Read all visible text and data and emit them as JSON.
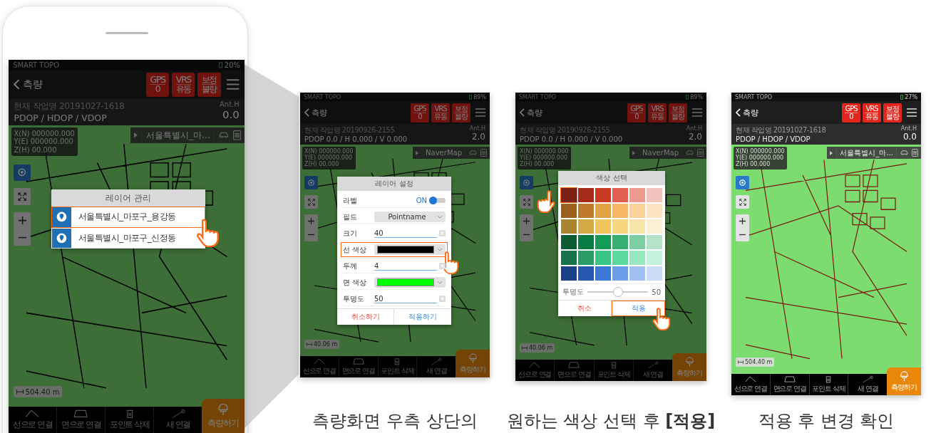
{
  "screens": [
    {
      "kind": "phone",
      "dimmed": true,
      "status": {
        "app": "SMART TOPO",
        "battery": "20%"
      },
      "header": {
        "title": "측량",
        "badges": [
          {
            "label": "GPS",
            "value": "0"
          },
          {
            "label": "VRS",
            "value": "유동"
          },
          {
            "label": "보정",
            "value": "불량"
          }
        ]
      },
      "info": {
        "job": "현재 작업명 20191027-1618",
        "dop": "PDOP / HDOP / VDOP",
        "ant_label": "Ant.H",
        "ant_value": "0.0"
      },
      "map": {
        "color": "#000000",
        "coords": [
          "X(N) 000000.000",
          "Y(E) 000000.000",
          "Z(H) 00.000"
        ],
        "layer": "서울특별시_마...",
        "scale": "504.40 m"
      },
      "tools": [
        "선으로 연결",
        "면으로 연결",
        "포인트 삭제",
        "새 연결"
      ],
      "measure": "측량하기",
      "dialog": {
        "kind": "layer_list",
        "title": "레이어 관리",
        "items": [
          {
            "name": "서울특별시_마포구_용강동",
            "selected": true
          },
          {
            "name": "서울특별시_마포구_신정동",
            "selected": false
          }
        ]
      }
    },
    {
      "kind": "plain",
      "dimmed": true,
      "caption": "측량화면 우측 상단의",
      "status": {
        "app": "SMART TOPO",
        "battery": "89%"
      },
      "header": {
        "title": "측량",
        "badges": [
          {
            "label": "GPS",
            "value": "0"
          },
          {
            "label": "VRS",
            "value": "유동"
          },
          {
            "label": "보정",
            "value": "불량"
          }
        ]
      },
      "info": {
        "job": "현재 작업명 20190926-2155",
        "dop": "PDOP 0.0 / H 0.000 / V 0.000",
        "ant_label": "Ant.H",
        "ant_value": "2.0"
      },
      "map": {
        "color": "#000000",
        "coords": [
          "X(N) 000000.000",
          "Y(E) 000000.000",
          "Z(H) 00.000"
        ],
        "layer": "NaverMap",
        "scale": "40.06 m"
      },
      "tools": [
        "선으로 연결",
        "면으로 연결",
        "포인트 삭제",
        "새 연결"
      ],
      "measure": "측량하기",
      "dialog": {
        "kind": "layer_settings",
        "title": "레이어 설정",
        "rows": [
          {
            "kind": "toggle",
            "label": "라벨",
            "value": "ON",
            "on": true,
            "selected": false
          },
          {
            "kind": "select",
            "label": "필드",
            "value": "Pointname",
            "selected": false
          },
          {
            "kind": "input",
            "label": "크기",
            "value": "40",
            "selected": false
          },
          {
            "kind": "color",
            "label": "선 색상",
            "color": "#000000",
            "selected": true
          },
          {
            "kind": "input",
            "label": "두께",
            "value": "4",
            "selected": false
          },
          {
            "kind": "color",
            "label": "면 색상",
            "color": "#00ff00",
            "selected": false
          },
          {
            "kind": "input",
            "label": "투명도",
            "value": "50",
            "selected": false
          }
        ],
        "buttons": [
          {
            "label": "취소하기",
            "kind": "cancel",
            "selected": false
          },
          {
            "label": "적용하기",
            "kind": "apply",
            "selected": false
          }
        ]
      }
    },
    {
      "kind": "plain",
      "dimmed": true,
      "caption": "원하는 색상 선택 후 **[적용]**",
      "status": {
        "app": "SMART TOPO",
        "battery": "89%"
      },
      "header": {
        "title": "측량",
        "badges": [
          {
            "label": "GPS",
            "value": "0"
          },
          {
            "label": "VRS",
            "value": "유동"
          },
          {
            "label": "보정",
            "value": "불량"
          }
        ]
      },
      "info": {
        "job": "현재 작업명 20190926-2155",
        "dop": "PDOP 0.0 / H 0.000 / V 0.000",
        "ant_label": "Ant.H",
        "ant_value": "2.0"
      },
      "map": {
        "color": "#000000",
        "coords": [
          "X(N) 000000.000",
          "Y(E) 000000.000",
          "Z(H) 00.000"
        ],
        "layer": "NaverMap",
        "scale": "40.06 m"
      },
      "tools": [
        "선으로 연결",
        "면으로 연결",
        "포인트 삭제",
        "새 연결"
      ],
      "measure": "측량하기",
      "dialog": {
        "kind": "color_picker",
        "title": "색상 선택",
        "swatches": [
          {
            "color": "#7b2014",
            "selected": true
          },
          {
            "color": "#a82a18",
            "selected": false
          },
          {
            "color": "#c93a22",
            "selected": false
          },
          {
            "color": "#e0604f",
            "selected": false
          },
          {
            "color": "#ec9b91",
            "selected": false
          },
          {
            "color": "#f3c3bd",
            "selected": false
          },
          {
            "color": "#9a5f1c",
            "selected": false
          },
          {
            "color": "#c07a2c",
            "selected": false
          },
          {
            "color": "#e3a146",
            "selected": false
          },
          {
            "color": "#f7b765",
            "selected": false
          },
          {
            "color": "#f9d19a",
            "selected": false
          },
          {
            "color": "#fbe3c4",
            "selected": false
          },
          {
            "color": "#a98530",
            "selected": false
          },
          {
            "color": "#d3ab46",
            "selected": false
          },
          {
            "color": "#f0c55e",
            "selected": false
          },
          {
            "color": "#f6d77d",
            "selected": false
          },
          {
            "color": "#f8e4a8",
            "selected": false
          },
          {
            "color": "#fbf0d2",
            "selected": false
          },
          {
            "color": "#0d5c36",
            "selected": false
          },
          {
            "color": "#0b7d44",
            "selected": false
          },
          {
            "color": "#169a57",
            "selected": false
          },
          {
            "color": "#37b072",
            "selected": false
          },
          {
            "color": "#7fcea3",
            "selected": false
          },
          {
            "color": "#b3e3c8",
            "selected": false
          },
          {
            "color": "#17714a",
            "selected": false
          },
          {
            "color": "#2a9a66",
            "selected": false
          },
          {
            "color": "#38c585",
            "selected": false
          },
          {
            "color": "#5bd89b",
            "selected": false
          },
          {
            "color": "#97e6c0",
            "selected": false
          },
          {
            "color": "#c5f2dd",
            "selected": false
          },
          {
            "color": "#1c3f86",
            "selected": false
          },
          {
            "color": "#2658b0",
            "selected": false
          },
          {
            "color": "#3a77d6",
            "selected": false
          },
          {
            "color": "#6b9de8",
            "selected": false
          },
          {
            "color": "#a0c0f2",
            "selected": false
          },
          {
            "color": "#cbdcf8",
            "selected": false
          }
        ],
        "slider": {
          "label": "투명도",
          "level": 0.5,
          "reading": "50"
        },
        "buttons": [
          {
            "label": "취소",
            "kind": "cancel",
            "selected": false
          },
          {
            "label": "적용",
            "kind": "apply",
            "selected": true
          }
        ]
      }
    },
    {
      "kind": "plain",
      "dimmed": false,
      "caption": "적용 후 변경 확인",
      "status": {
        "app": "SMART TOPO",
        "battery": "27%"
      },
      "header": {
        "title": "측량",
        "badges": [
          {
            "label": "GPS",
            "value": "0"
          },
          {
            "label": "VRS",
            "value": "유동"
          },
          {
            "label": "보정",
            "value": "불량"
          }
        ]
      },
      "info": {
        "job": "현재 작업명 20191027-1618",
        "dop": "PDOP / HDOP / VDOP",
        "ant_label": "Ant.H",
        "ant_value": "0.0"
      },
      "map": {
        "color": "#7a1a10",
        "coords": [
          "X(N) 000000.000",
          "Y(E) 000000.000",
          "Z(H) 00.000"
        ],
        "layer": "서울특별시_마...",
        "scale": "504.40 m"
      },
      "tools": [
        "선으로 연결",
        "면으로 연결",
        "포인트 삭제",
        "새 연결"
      ],
      "measure": "측량하기"
    }
  ]
}
